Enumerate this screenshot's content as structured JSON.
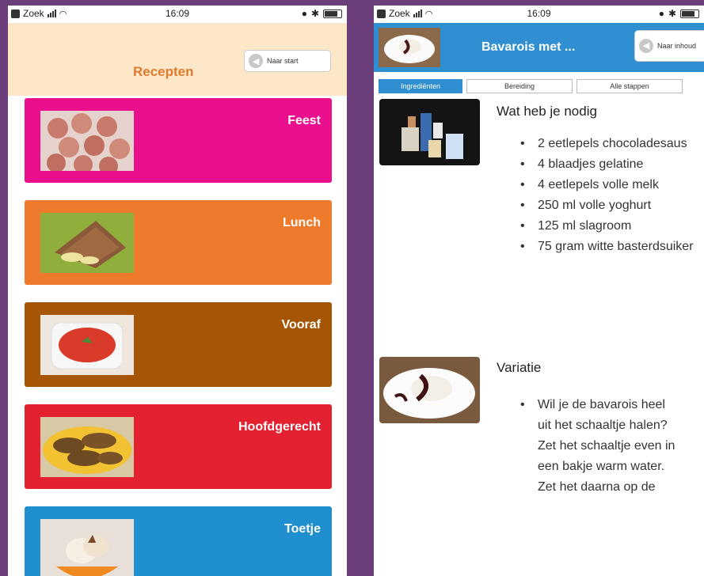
{
  "left_screen": {
    "status": {
      "carrier": "Zoek",
      "time": "16:09"
    },
    "title": "Recepten",
    "back_button": "Naar start",
    "categories": [
      {
        "label": "Feest",
        "color": "#ea0f8d",
        "image": "feest-cupcakes"
      },
      {
        "label": "Lunch",
        "color": "#ee7a2c",
        "image": "lunch-sandwich"
      },
      {
        "label": "Vooraf",
        "color": "#a65505",
        "image": "vooraf-soup"
      },
      {
        "label": "Hoofdgerecht",
        "color": "#e42130",
        "image": "hoofdgerecht-pancakes"
      },
      {
        "label": "Toetje",
        "color": "#1f8fd0",
        "image": "toetje-icecream"
      }
    ]
  },
  "right_screen": {
    "status": {
      "carrier": "Zoek",
      "time": "16:09"
    },
    "title": "Bavarois met ...",
    "back_button": "Naar inhoud",
    "tabs": [
      {
        "label": "Ingrediënten",
        "active": true
      },
      {
        "label": "Bereiding",
        "active": false
      },
      {
        "label": "Alle stappen",
        "active": false
      }
    ],
    "ingredients_title": "Wat heb je nodig",
    "ingredients": [
      "2 eetlepels chocoladesaus",
      "4 blaadjes gelatine",
      "4 eetlepels volle melk",
      "250 ml volle yoghurt",
      "125 ml slagroom",
      "75 gram witte basterdsuiker"
    ],
    "variation_title": "Variatie",
    "variation_items": [
      "Wil je de bavarois heel uit het schaaltje halen? Zet het schaaltje even in een bakje warm water. Zet het daarna op de"
    ]
  }
}
